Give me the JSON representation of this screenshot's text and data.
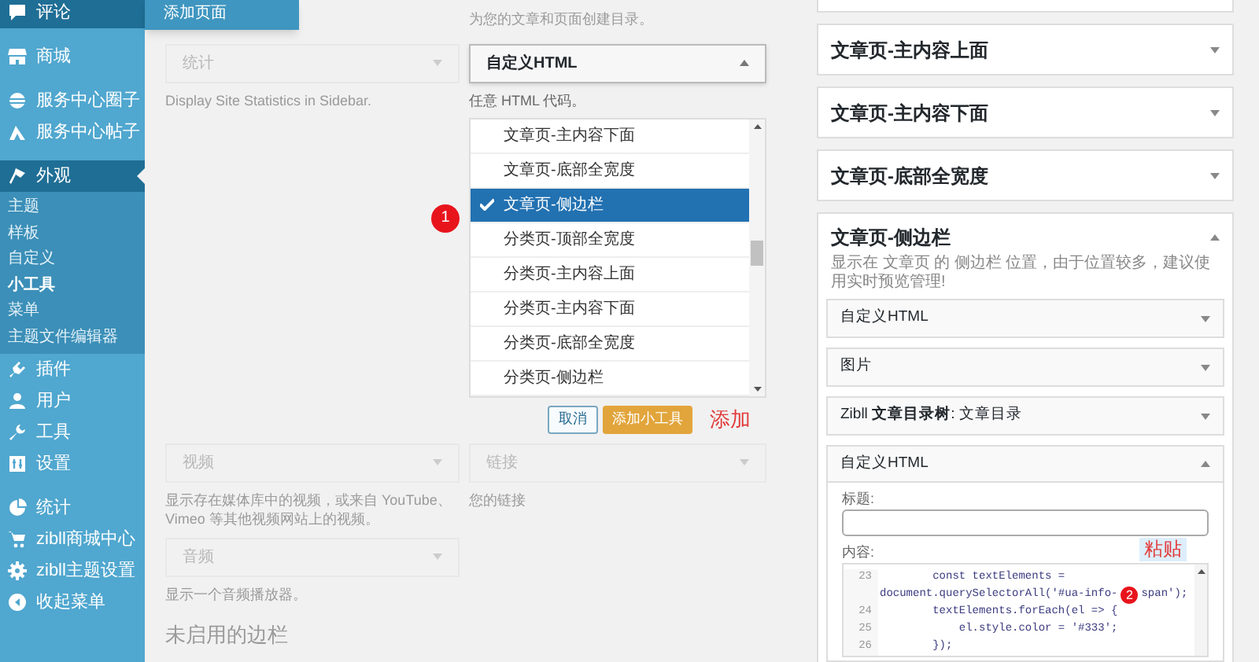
{
  "admin_menu": {
    "flyout": {
      "label": "添加页面"
    },
    "groups": [
      [
        {
          "label": "评论",
          "hovered": true,
          "selected": false
        }
      ],
      [
        {
          "label": "商城",
          "hovered": false,
          "selected": false
        }
      ],
      [
        {
          "label": "服务中心圈子",
          "hovered": false,
          "selected": false
        },
        {
          "label": "服务中心帖子",
          "hovered": false,
          "selected": false
        }
      ],
      [
        {
          "label": "外观",
          "hovered": false,
          "selected": true,
          "children": [
            {
              "label": "主题",
              "selected": false
            },
            {
              "label": "样板",
              "selected": false
            },
            {
              "label": "自定义",
              "selected": false
            },
            {
              "label": "小工具",
              "selected": true
            },
            {
              "label": "菜单",
              "selected": false
            },
            {
              "label": "主题文件编辑器",
              "selected": false
            }
          ]
        },
        {
          "label": "插件",
          "hovered": false,
          "selected": false
        },
        {
          "label": "用户",
          "hovered": false,
          "selected": false
        },
        {
          "label": "工具",
          "hovered": false,
          "selected": false
        },
        {
          "label": "设置",
          "hovered": false,
          "selected": false
        }
      ],
      [
        {
          "label": "统计",
          "hovered": false,
          "selected": false
        },
        {
          "label": "zibll商城中心",
          "hovered": false,
          "selected": false
        },
        {
          "label": "zibll主题设置",
          "hovered": false,
          "selected": false
        },
        {
          "label": "收起菜单",
          "hovered": false,
          "selected": false
        }
      ]
    ]
  },
  "available_widgets": {
    "rows": [
      {
        "right": {
          "kind": "description",
          "text": "为您的文章和页面创建目录。",
          "dimmed": true
        }
      },
      {
        "left": {
          "kind": "widget",
          "title": "统计",
          "expanded": false,
          "dimmed": true,
          "description": "Display Site Statistics in Sidebar."
        },
        "right": {
          "kind": "widget",
          "title": "自定义HTML",
          "expanded": true,
          "dimmed": false,
          "description": "任意 HTML 代码。",
          "chooser": {
            "options": [
              {
                "label": "文章页-主内容下面",
                "selected": false
              },
              {
                "label": "文章页-底部全宽度",
                "selected": false
              },
              {
                "label": "文章页-侧边栏",
                "selected": true
              },
              {
                "label": "分类页-顶部全宽度",
                "selected": false
              },
              {
                "label": "分类页-主内容上面",
                "selected": false
              },
              {
                "label": "分类页-主内容下面",
                "selected": false
              },
              {
                "label": "分类页-底部全宽度",
                "selected": false
              },
              {
                "label": "分类页-侧边栏",
                "selected": false
              }
            ],
            "cancel": "取消",
            "add": "添加小工具",
            "badge": "1",
            "note": "添加"
          }
        }
      },
      {
        "left": {
          "kind": "widget",
          "title": "视频",
          "expanded": false,
          "dimmed": true,
          "description": "显示存在媒体库中的视频，或来自 YouTube、Vimeo 等其他视频网站上的视频。"
        },
        "right": {
          "kind": "widget",
          "title": "链接",
          "expanded": false,
          "dimmed": true,
          "description": "您的链接"
        }
      },
      {
        "left": {
          "kind": "widget",
          "title": "音频",
          "expanded": false,
          "dimmed": true,
          "description": "显示一个音频播放器。"
        }
      }
    ],
    "inactive_heading": "未启用的边栏"
  },
  "sidebars": [
    {
      "title": "文章页-主内容上面",
      "expanded": false
    },
    {
      "title": "文章页-主内容下面",
      "expanded": false
    },
    {
      "title": "文章页-底部全宽度",
      "expanded": false
    },
    {
      "title": "文章页-侧边栏",
      "expanded": true,
      "description": "显示在 文章页 的 侧边栏 位置，由于位置较多，建议使用实时预览管理!",
      "widgets": [
        {
          "title": "自定义HTML",
          "expanded": false
        },
        {
          "title": "图片",
          "expanded": false
        },
        {
          "title": "Zibll **文章目录树**: 文章目录",
          "expanded": false
        },
        {
          "title": "自定义HTML",
          "expanded": true,
          "title_label": "标题:",
          "content_label": "内容:",
          "badge": "2",
          "note": "粘贴",
          "code": [
            {
              "number": "23",
              "segments": [
                "        const textElements ="
              ]
            },
            {
              "segments": [
                "document.querySelectorAll('#ua-info-",
                "span');"
              ]
            },
            {
              "number": "24",
              "segments": [
                "        textElements.forEach(el => {"
              ]
            },
            {
              "number": "25",
              "segments": [
                "            el.style.color = '#333';"
              ]
            },
            {
              "number": "26",
              "segments": [
                "        });"
              ]
            }
          ]
        }
      ]
    }
  ]
}
